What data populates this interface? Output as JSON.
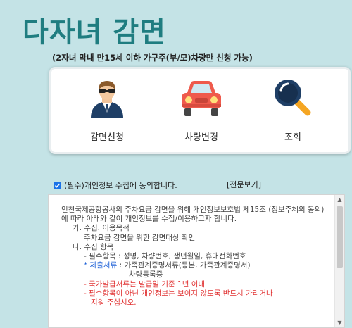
{
  "header": {
    "title": "다자녀 감면",
    "subtitle": "(2자녀 막내 만15세 이하 가구주(부/모)차량만 신청 가능)"
  },
  "menu": {
    "items": [
      {
        "label": "감면신청",
        "icon": "agent-person-icon"
      },
      {
        "label": "차량변경",
        "icon": "car-icon"
      },
      {
        "label": "조회",
        "icon": "magnifier-icon"
      }
    ]
  },
  "consent": {
    "label": "(필수)개인정보 수집에 동의합니다.",
    "view_full": "[전문보기]",
    "checked": true
  },
  "terms": {
    "intro": "인천국제공항공사의 주차요금 감면을 위해 개인정보보호법 제15조 (정보주체의 동의)에 따라 아래와 같이 개인정보를 수집/이용하고자 합니다.",
    "section1_heading": "가. 수집. 이용목적",
    "section1_body": "주차요금 감면을 위한 감면대상 확인",
    "section2_heading": "나. 수집 항목",
    "required_items": "- 필수항목 : 성명, 차량번호, 생년월일, 휴대전화번호",
    "submit_docs_prefix": "* ",
    "submit_docs_label": "제출서류",
    "submit_docs_text": " : 가족관계증명서류(등본, 가족관계증명서)",
    "submit_docs_text2": "차량등록증",
    "notice1": "- 국가발급서류는 발급일 기준 1년 이내",
    "notice2": "- 필수항목이 아닌 개인정보는 보이지 않도록 반드시 가리거나",
    "notice3": "지워 주십시오."
  },
  "colors": {
    "background": "#c4e3e6",
    "title": "#1f7d80",
    "checkbox": "#1a73e8",
    "warning": "#e03030",
    "highlight": "#1a5ed6",
    "car": "#ef5a4c"
  }
}
